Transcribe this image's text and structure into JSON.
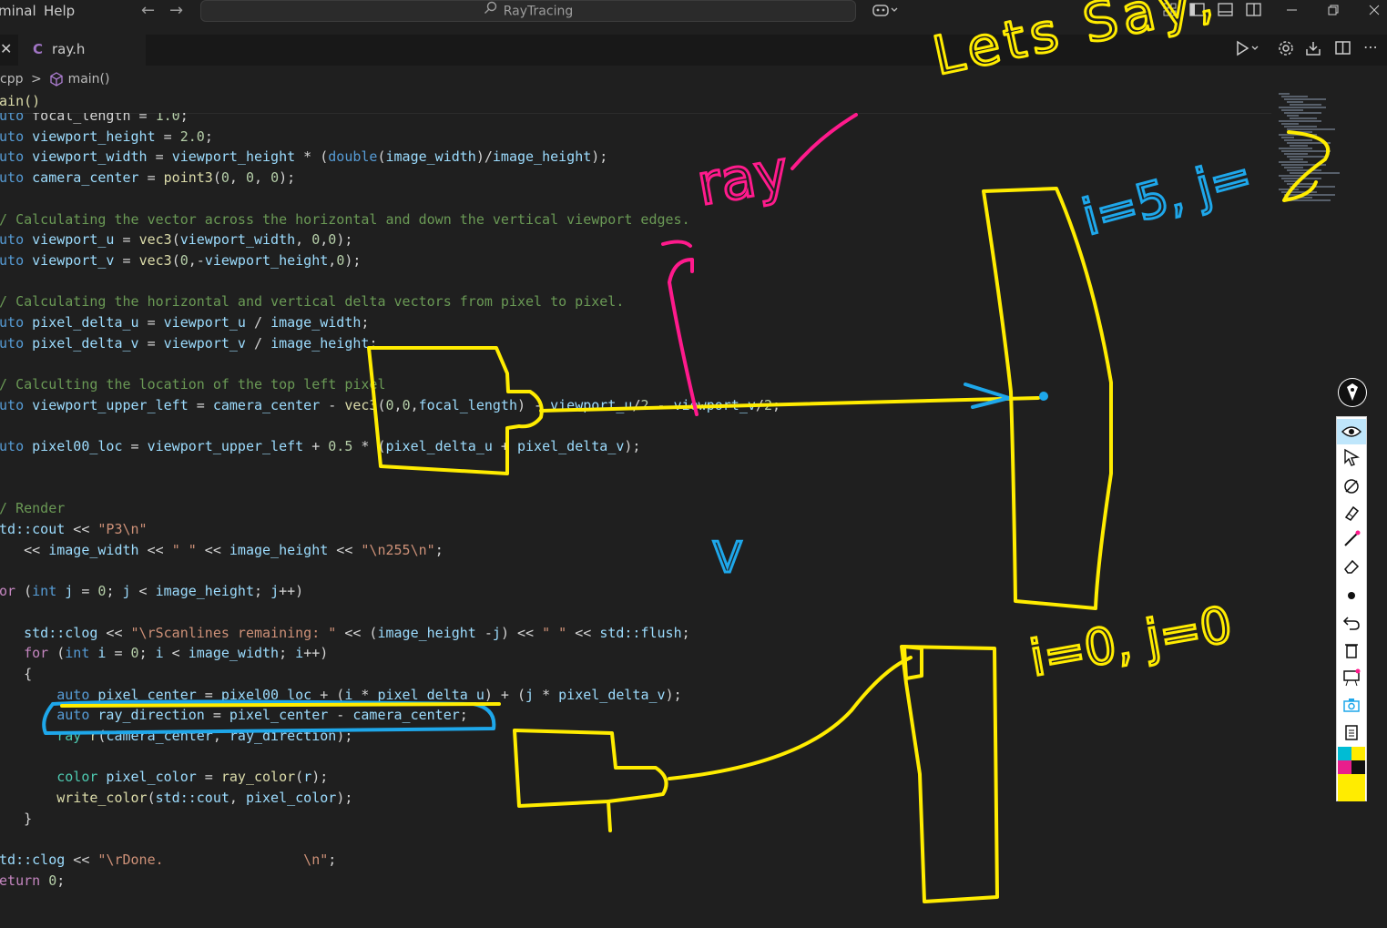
{
  "menu": {
    "terminal": "minal",
    "help": "Help"
  },
  "search": {
    "text": "RayTracing"
  },
  "tabs": [
    {
      "icon": "C",
      "label": "ray.h"
    }
  ],
  "breadcrumb": {
    "file": "cpp",
    "separator": ">",
    "symbol": "main()"
  },
  "sticky_scroll": "main()",
  "code_lines": [
    {
      "segs": [
        [
          "kw",
          "auto"
        ],
        [
          "op",
          " focal_length = "
        ],
        [
          "num",
          "1.0"
        ],
        [
          "op",
          ";"
        ]
      ]
    },
    {
      "segs": [
        [
          "kw",
          "auto"
        ],
        [
          "var",
          " viewport_height"
        ],
        [
          "op",
          " = "
        ],
        [
          "num",
          "2.0"
        ],
        [
          "op",
          ";"
        ]
      ]
    },
    {
      "segs": [
        [
          "kw",
          "auto"
        ],
        [
          "var",
          " viewport_width"
        ],
        [
          "op",
          " = "
        ],
        [
          "var",
          "viewport_height"
        ],
        [
          "op",
          " * ("
        ],
        [
          "kw",
          "double"
        ],
        [
          "op",
          "("
        ],
        [
          "var",
          "image_width"
        ],
        [
          "op",
          ")/"
        ],
        [
          "var",
          "image_height"
        ],
        [
          "op",
          ");"
        ]
      ]
    },
    {
      "segs": [
        [
          "kw",
          "auto"
        ],
        [
          "var",
          " camera_center"
        ],
        [
          "op",
          " = "
        ],
        [
          "fn",
          "point3"
        ],
        [
          "op",
          "("
        ],
        [
          "num",
          "0"
        ],
        [
          "op",
          ", "
        ],
        [
          "num",
          "0"
        ],
        [
          "op",
          ", "
        ],
        [
          "num",
          "0"
        ],
        [
          "op",
          ");"
        ]
      ]
    },
    {
      "segs": []
    },
    {
      "segs": [
        [
          "cmt",
          "// Calculating the vector across the horizontal and down the vertical viewport edges."
        ]
      ]
    },
    {
      "segs": [
        [
          "kw",
          "auto"
        ],
        [
          "var",
          " viewport_u"
        ],
        [
          "op",
          " = "
        ],
        [
          "fn",
          "vec3"
        ],
        [
          "op",
          "("
        ],
        [
          "var",
          "viewport_width"
        ],
        [
          "op",
          ", "
        ],
        [
          "num",
          "0"
        ],
        [
          "op",
          ","
        ],
        [
          "num",
          "0"
        ],
        [
          "op",
          ");"
        ]
      ]
    },
    {
      "segs": [
        [
          "kw",
          "auto"
        ],
        [
          "var",
          " viewport_v"
        ],
        [
          "op",
          " = "
        ],
        [
          "fn",
          "vec3"
        ],
        [
          "op",
          "("
        ],
        [
          "num",
          "0"
        ],
        [
          "op",
          ",-"
        ],
        [
          "var",
          "viewport_height"
        ],
        [
          "op",
          ","
        ],
        [
          "num",
          "0"
        ],
        [
          "op",
          ");"
        ]
      ]
    },
    {
      "segs": []
    },
    {
      "segs": [
        [
          "cmt",
          "// Calculating the horizontal and vertical delta vectors from pixel to pixel."
        ]
      ]
    },
    {
      "segs": [
        [
          "kw",
          "auto"
        ],
        [
          "var",
          " pixel_delta_u"
        ],
        [
          "op",
          " = "
        ],
        [
          "var",
          "viewport_u"
        ],
        [
          "op",
          " / "
        ],
        [
          "var",
          "image_width"
        ],
        [
          "op",
          ";"
        ]
      ]
    },
    {
      "segs": [
        [
          "kw",
          "auto"
        ],
        [
          "var",
          " pixel_delta_v"
        ],
        [
          "op",
          " = "
        ],
        [
          "var",
          "viewport_v"
        ],
        [
          "op",
          " / "
        ],
        [
          "var",
          "image_height"
        ],
        [
          "op",
          ";"
        ]
      ]
    },
    {
      "segs": []
    },
    {
      "segs": [
        [
          "cmt",
          "// Calculting the location of the top left pixel"
        ]
      ]
    },
    {
      "segs": [
        [
          "kw",
          "auto"
        ],
        [
          "var",
          " viewport_upper_left"
        ],
        [
          "op",
          " = "
        ],
        [
          "var",
          "camera_center"
        ],
        [
          "op",
          " - "
        ],
        [
          "fn",
          "vec3"
        ],
        [
          "op",
          "("
        ],
        [
          "num",
          "0"
        ],
        [
          "op",
          ","
        ],
        [
          "num",
          "0"
        ],
        [
          "op",
          ","
        ],
        [
          "var",
          "focal_length"
        ],
        [
          "op",
          ") - "
        ],
        [
          "var",
          "viewport_u"
        ],
        [
          "op",
          "/"
        ],
        [
          "num",
          "2"
        ],
        [
          "op",
          " - "
        ],
        [
          "var",
          "viewport_v"
        ],
        [
          "op",
          "/"
        ],
        [
          "num",
          "2"
        ],
        [
          "op",
          ";"
        ]
      ]
    },
    {
      "segs": []
    },
    {
      "segs": [
        [
          "kw",
          "auto"
        ],
        [
          "var",
          " pixel00_loc"
        ],
        [
          "op",
          " = "
        ],
        [
          "var",
          "viewport_upper_left"
        ],
        [
          "op",
          " + "
        ],
        [
          "num",
          "0.5"
        ],
        [
          "op",
          " * ("
        ],
        [
          "var",
          "pixel_delta_u"
        ],
        [
          "op",
          " + "
        ],
        [
          "var",
          "pixel_delta_v"
        ],
        [
          "op",
          ");"
        ]
      ]
    },
    {
      "segs": []
    },
    {
      "segs": []
    },
    {
      "segs": [
        [
          "cmt",
          "// Render"
        ]
      ]
    },
    {
      "segs": [
        [
          "var",
          "std::cout"
        ],
        [
          "op",
          " << "
        ],
        [
          "str",
          "\"P3\\n\""
        ]
      ]
    },
    {
      "segs": [
        [
          "op",
          "    << "
        ],
        [
          "var",
          "image_width"
        ],
        [
          "op",
          " << "
        ],
        [
          "str",
          "\" \""
        ],
        [
          "op",
          " << "
        ],
        [
          "var",
          "image_height"
        ],
        [
          "op",
          " << "
        ],
        [
          "str",
          "\"\\n255\\n\""
        ],
        [
          "op",
          ";"
        ]
      ]
    },
    {
      "segs": []
    },
    {
      "segs": [
        [
          "ctl",
          "for"
        ],
        [
          "op",
          " ("
        ],
        [
          "kw",
          "int"
        ],
        [
          "var",
          " j"
        ],
        [
          "op",
          " = "
        ],
        [
          "num",
          "0"
        ],
        [
          "op",
          "; "
        ],
        [
          "var",
          "j"
        ],
        [
          "op",
          " < "
        ],
        [
          "var",
          "image_height"
        ],
        [
          "op",
          "; "
        ],
        [
          "var",
          "j"
        ],
        [
          "op",
          "++)"
        ]
      ]
    },
    {
      "segs": [
        [
          "op",
          "{"
        ]
      ]
    },
    {
      "segs": [
        [
          "var",
          "    std::clog"
        ],
        [
          "op",
          " << "
        ],
        [
          "str",
          "\"\\rScanlines remaining: \""
        ],
        [
          "op",
          " << ("
        ],
        [
          "var",
          "image_height"
        ],
        [
          "op",
          " -"
        ],
        [
          "var",
          "j"
        ],
        [
          "op",
          ") << "
        ],
        [
          "str",
          "\" \""
        ],
        [
          "op",
          " << "
        ],
        [
          "var",
          "std::flush"
        ],
        [
          "op",
          ";"
        ]
      ]
    },
    {
      "segs": [
        [
          "ctl",
          "    for"
        ],
        [
          "op",
          " ("
        ],
        [
          "kw",
          "int"
        ],
        [
          "var",
          " i"
        ],
        [
          "op",
          " = "
        ],
        [
          "num",
          "0"
        ],
        [
          "op",
          "; "
        ],
        [
          "var",
          "i"
        ],
        [
          "op",
          " < "
        ],
        [
          "var",
          "image_width"
        ],
        [
          "op",
          "; "
        ],
        [
          "var",
          "i"
        ],
        [
          "op",
          "++)"
        ]
      ]
    },
    {
      "segs": [
        [
          "op",
          "    {"
        ]
      ]
    },
    {
      "segs": [
        [
          "kw",
          "        auto"
        ],
        [
          "var",
          " pixel_center"
        ],
        [
          "op",
          " = "
        ],
        [
          "var",
          "pixel00_loc"
        ],
        [
          "op",
          " + ("
        ],
        [
          "var",
          "i"
        ],
        [
          "op",
          " * "
        ],
        [
          "var",
          "pixel_delta_u"
        ],
        [
          "op",
          ") + ("
        ],
        [
          "var",
          "j"
        ],
        [
          "op",
          " * "
        ],
        [
          "var",
          "pixel_delta_v"
        ],
        [
          "op",
          ");"
        ]
      ]
    },
    {
      "segs": [
        [
          "kw",
          "        auto"
        ],
        [
          "var",
          " ray_direction"
        ],
        [
          "op",
          " = "
        ],
        [
          "var",
          "pixel_center"
        ],
        [
          "op",
          " - "
        ],
        [
          "var",
          "camera_center"
        ],
        [
          "op",
          ";"
        ]
      ]
    },
    {
      "segs": [
        [
          "ty",
          "        ray"
        ],
        [
          "fn",
          " r"
        ],
        [
          "op",
          "("
        ],
        [
          "var",
          "camera_center"
        ],
        [
          "op",
          ", "
        ],
        [
          "var",
          "ray_direction"
        ],
        [
          "op",
          ");"
        ]
      ]
    },
    {
      "segs": []
    },
    {
      "segs": [
        [
          "ty",
          "        color"
        ],
        [
          "var",
          " pixel_color"
        ],
        [
          "op",
          " = "
        ],
        [
          "fn",
          "ray_color"
        ],
        [
          "op",
          "("
        ],
        [
          "var",
          "r"
        ],
        [
          "op",
          ");"
        ]
      ]
    },
    {
      "segs": [
        [
          "fn",
          "        write_color"
        ],
        [
          "op",
          "("
        ],
        [
          "var",
          "std::cout"
        ],
        [
          "op",
          ", "
        ],
        [
          "var",
          "pixel_color"
        ],
        [
          "op",
          ");"
        ]
      ]
    },
    {
      "segs": [
        [
          "op",
          "    }"
        ]
      ]
    },
    {
      "segs": [
        [
          "op",
          "}"
        ]
      ]
    },
    {
      "segs": [
        [
          "var",
          "std::clog"
        ],
        [
          "op",
          " << "
        ],
        [
          "str",
          "\"\\rDone.                 \\n\""
        ],
        [
          "op",
          ";"
        ]
      ]
    },
    {
      "segs": [
        [
          "ctl",
          "return"
        ],
        [
          "op",
          " "
        ],
        [
          "num",
          "0"
        ],
        [
          "op",
          ";"
        ]
      ]
    }
  ],
  "annotations": {
    "lets_say": "Lets Say,",
    "ray": "ray",
    "i5j": "i=5, j=",
    "i0j0": "i=0, j=0",
    "v": "V"
  },
  "colors": {
    "pen_yellow": "#ffec00",
    "pen_pink": "#ff1a8c",
    "pen_blue": "#1ea7ea",
    "editor_bg": "#1f1f1f"
  },
  "toolbar_icons": [
    "eye-icon",
    "pointer-icon",
    "eraser-lasso-icon",
    "highlighter-icon",
    "pen-line-icon",
    "eraser-icon",
    "dot-icon",
    "undo-icon",
    "trash-icon",
    "whiteboard-icon",
    "camera-icon",
    "clipboard-icon",
    "palette-icon"
  ]
}
